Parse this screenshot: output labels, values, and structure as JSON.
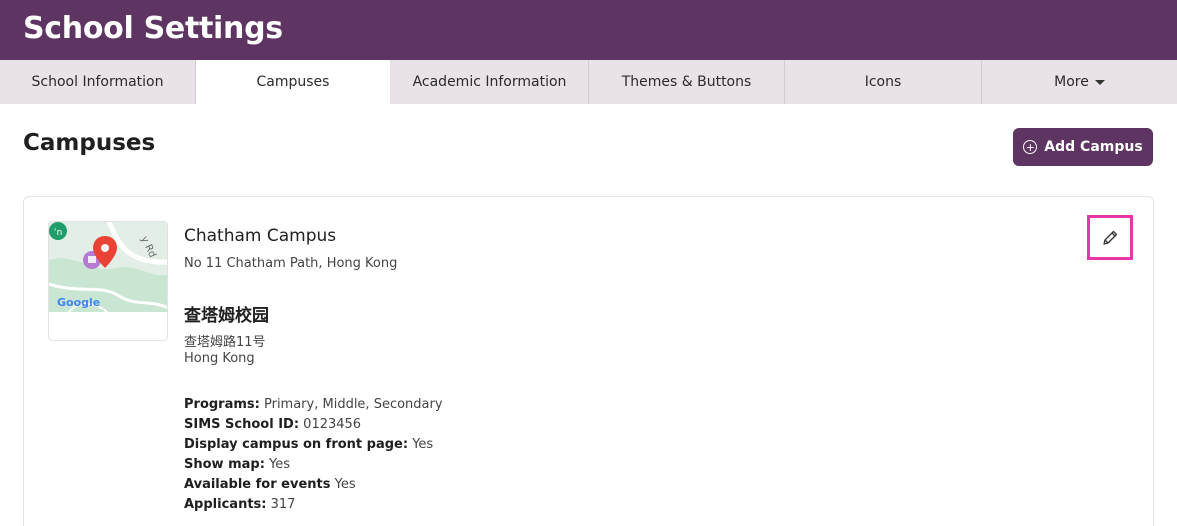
{
  "header": {
    "title": "School Settings"
  },
  "tabs": [
    {
      "label": "School Information",
      "active": false
    },
    {
      "label": "Campuses",
      "active": true
    },
    {
      "label": "Academic Information",
      "active": false
    },
    {
      "label": "Themes & Buttons",
      "active": false
    },
    {
      "label": "Icons",
      "active": false
    },
    {
      "label": "More",
      "active": false
    }
  ],
  "main": {
    "title": "Campuses",
    "add_button_label": "Add Campus",
    "add_icon": "plus-circle-icon"
  },
  "campus": {
    "name": "Chatham Campus",
    "address": "No 11 Chatham Path, Hong Kong",
    "name_zh": "查塔姆校园",
    "address_zh_line1": "查塔姆路11号",
    "address_zh_line2": "Hong Kong",
    "map": {
      "brand": "Google",
      "road_label": "y Rd",
      "icon": "map-pin-icon"
    },
    "edit_icon": "pencil-icon",
    "details": [
      {
        "label": "Programs:",
        "value": "Primary, Middle, Secondary"
      },
      {
        "label": "SIMS School ID:",
        "value": "0123456"
      },
      {
        "label": "Display campus on front page:",
        "value": "Yes"
      },
      {
        "label": "Show map:",
        "value": "Yes"
      },
      {
        "label": "Available for events",
        "value": "Yes"
      },
      {
        "label": "Applicants:",
        "value": "317"
      }
    ]
  },
  "colors": {
    "brand": "#5e3462",
    "tab_bg": "#e9e2e8",
    "highlight": "#e636a8",
    "pin": "#ea4335"
  }
}
